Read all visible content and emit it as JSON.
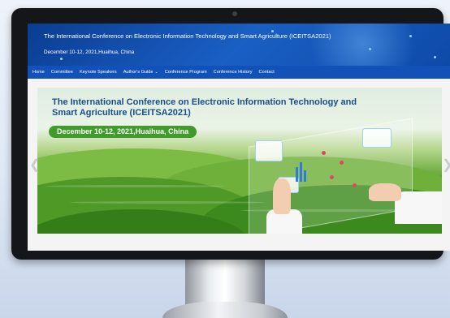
{
  "site": {
    "title": "The International Conference on Electronic Information Technology and Smart Agriculture (ICEITSA2021)",
    "date": "December 10-12, 2021,Huaihua, China"
  },
  "nav": {
    "items": [
      {
        "label": "Home"
      },
      {
        "label": "Committee"
      },
      {
        "label": "Keynote Speakers"
      },
      {
        "label": "Author's Guide"
      },
      {
        "label": "Conference Program"
      },
      {
        "label": "Conference History"
      },
      {
        "label": "Contact"
      }
    ]
  },
  "banner": {
    "title": "The International Conference on Electronic Information Technology and Smart Agriculture (ICEITSA2021)",
    "date": "December 10-12, 2021,Huaihua, China"
  },
  "icons": {
    "prev": "chevron-left-icon",
    "next": "chevron-right-icon",
    "dropdown": "chevron-down-icon"
  },
  "colors": {
    "header": "#0e4aa8",
    "nav": "#1151b8",
    "banner_title": "#1a4d8c",
    "date_pill": "#3f9b2a"
  }
}
